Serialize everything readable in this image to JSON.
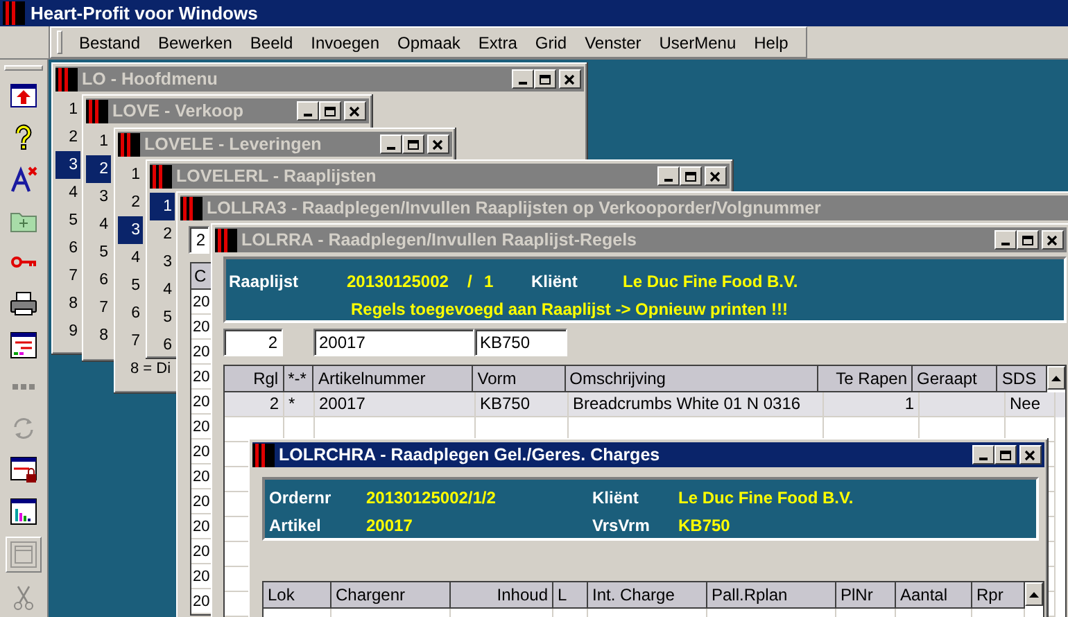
{
  "app": {
    "title": "Heart-Profit voor Windows"
  },
  "menu": [
    "Bestand",
    "Bewerken",
    "Beeld",
    "Invoegen",
    "Opmaak",
    "Extra",
    "Grid",
    "Venster",
    "UserMenu",
    "Help"
  ],
  "toolbar": [
    {
      "kind": "import",
      "disabled": false,
      "pressed": false
    },
    {
      "kind": "help",
      "disabled": false,
      "pressed": false
    },
    {
      "kind": "font",
      "disabled": false,
      "pressed": false
    },
    {
      "kind": "folder",
      "disabled": false,
      "pressed": false
    },
    {
      "kind": "key",
      "disabled": false,
      "pressed": false
    },
    {
      "kind": "print",
      "disabled": false,
      "pressed": false
    },
    {
      "kind": "form",
      "disabled": false,
      "pressed": false
    },
    {
      "kind": "dots",
      "disabled": true,
      "pressed": false
    },
    {
      "kind": "refresh",
      "disabled": true,
      "pressed": false
    },
    {
      "kind": "lock",
      "disabled": false,
      "pressed": false
    },
    {
      "kind": "chart",
      "disabled": false,
      "pressed": false
    },
    {
      "kind": "window",
      "disabled": true,
      "pressed": true
    },
    {
      "kind": "cut",
      "disabled": true,
      "pressed": false
    }
  ],
  "windows": [
    {
      "kind": "menu",
      "title": "LO - Hoofdmenu",
      "active": false,
      "items": [
        {
          "label": "1",
          "selected": false
        },
        {
          "label": "2",
          "selected": false
        },
        {
          "label": "3",
          "selected": true
        },
        {
          "label": "4",
          "selected": false
        },
        {
          "label": "5",
          "selected": false
        },
        {
          "label": "6",
          "selected": false
        },
        {
          "label": "7",
          "selected": false
        },
        {
          "label": "8",
          "selected": false
        },
        {
          "label": "9",
          "selected": false
        }
      ]
    },
    {
      "kind": "menu",
      "title": "LOVE - Verkoop",
      "active": false,
      "items": [
        {
          "label": "1",
          "selected": false
        },
        {
          "label": "2",
          "selected": true
        },
        {
          "label": "3",
          "selected": false
        },
        {
          "label": "4",
          "selected": false
        },
        {
          "label": "5",
          "selected": false
        },
        {
          "label": "6",
          "selected": false
        },
        {
          "label": "7",
          "selected": false
        },
        {
          "label": "8",
          "selected": false
        }
      ]
    },
    {
      "kind": "menu",
      "title": "LOVELE - Leveringen",
      "active": false,
      "items": [
        {
          "label": "1",
          "selected": false
        },
        {
          "label": "2",
          "selected": false
        },
        {
          "label": "3",
          "selected": true
        },
        {
          "label": "4",
          "selected": false
        },
        {
          "label": "5",
          "selected": false
        },
        {
          "label": "6",
          "selected": false
        },
        {
          "label": "7",
          "selected": false
        },
        {
          "label": "8 = Di",
          "selected": false
        }
      ]
    },
    {
      "kind": "menu",
      "title": "LOVELERL - Raaplijsten",
      "active": false,
      "items": [
        {
          "label": "1",
          "selected": true
        },
        {
          "label": "2",
          "selected": false
        },
        {
          "label": "3",
          "selected": false
        },
        {
          "label": "4",
          "selected": false
        },
        {
          "label": "5",
          "selected": false
        },
        {
          "label": "6",
          "selected": false
        }
      ]
    },
    {
      "kind": "lookup",
      "title": "LOLLRA3 - Raadplegen/Invullen Raaplijsten op Verkooporder/Volgnummer",
      "active": false,
      "field": "2",
      "column_1": "C",
      "cells": [
        "20",
        "20",
        "20",
        "20",
        "20",
        "20",
        "20",
        "20",
        "20",
        "20",
        "20",
        "20",
        "20"
      ]
    },
    {
      "kind": "lines",
      "title": "LOLRRA - Raadplegen/Invullen Raaplijst-Regels",
      "active": false,
      "header": {
        "label": "Raaplijst",
        "number": "20130125002",
        "separator": "/",
        "sequence": "1",
        "client_label": "Kliënt",
        "client": "Le Duc Fine Food B.V.",
        "message": "Regels toegevoegd aan Raaplijst -> Opnieuw printen !!!"
      },
      "inputs": [
        "2",
        "20017",
        "KB750"
      ],
      "columns": [
        "Rgl",
        "*-*",
        "Artikelnummer",
        "Vorm",
        "Omschrijving",
        "Te Rapen",
        "Geraapt",
        "SDS"
      ],
      "rows": [
        {
          "cells": [
            "2",
            "*",
            "20017",
            "KB750",
            "Breadcrumbs White 01 N 0316",
            "1",
            "",
            "Nee"
          ],
          "selected": true
        }
      ]
    },
    {
      "kind": "charges",
      "title": "LOLRCHRA - Raadplegen Gel./Geres. Charges",
      "active": true,
      "fields": [
        {
          "label": "Ordernr",
          "value": "20130125002/1/2"
        },
        {
          "label": "Kliënt",
          "value": "Le Duc Fine Food B.V."
        },
        {
          "label": "Artikel",
          "value": "20017"
        },
        {
          "label": "VrsVrm",
          "value": "KB750"
        }
      ],
      "columns": [
        "Lok",
        "Chargenr",
        "Inhoud",
        "L",
        "Int. Charge",
        "Pall.Rplan",
        "PlNr",
        "Aantal",
        "Rpr"
      ]
    }
  ]
}
